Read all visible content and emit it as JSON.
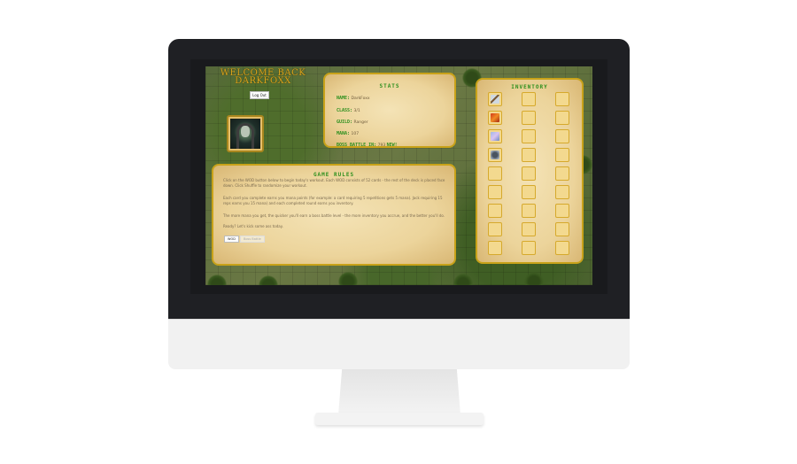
{
  "header": {
    "welcome_line1": "WELCOME BACK",
    "welcome_line2": "DARKFOXX",
    "logout_label": "Log Out"
  },
  "stats": {
    "title": "STATS",
    "name_key": "NAME:",
    "name_value": "DarkFoxx",
    "class_key": "CLASS:",
    "class_value": "3/1",
    "guild_key": "GUILD:",
    "guild_value": "Ranger",
    "mana_key": "MANA:",
    "mana_value": "107",
    "boss_key": "BOSS BATTLE IN:",
    "boss_value": "793",
    "boss_suffix": "NEW!"
  },
  "rules": {
    "title": "GAME RULES",
    "paragraphs": [
      "Click on the WOD button below to begin today's workout. Each WOD consists of 52 cards - the rest of the deck is placed face down. Click Shuffle to randomize your workout.",
      "Each card you complete earns you mana points (for example: a card requiring 5 repetitions gets 5 mana). Jack requiring 15 reps earns you 15 mana) and each completed round earns you inventory.",
      "The more mana you get, the quicker you'll earn a boss battle level - the more inventory you accrue, and the better you'll do.",
      "Ready? Let's kick some ass today."
    ],
    "wod_button": "WOD",
    "boss_button": "Boss Battle"
  },
  "inventory": {
    "title": "INVENTORY",
    "items": [
      "sword-icon",
      "fire-icon",
      "crystal-icon",
      "armor-icon"
    ],
    "empty_slots": 23
  }
}
